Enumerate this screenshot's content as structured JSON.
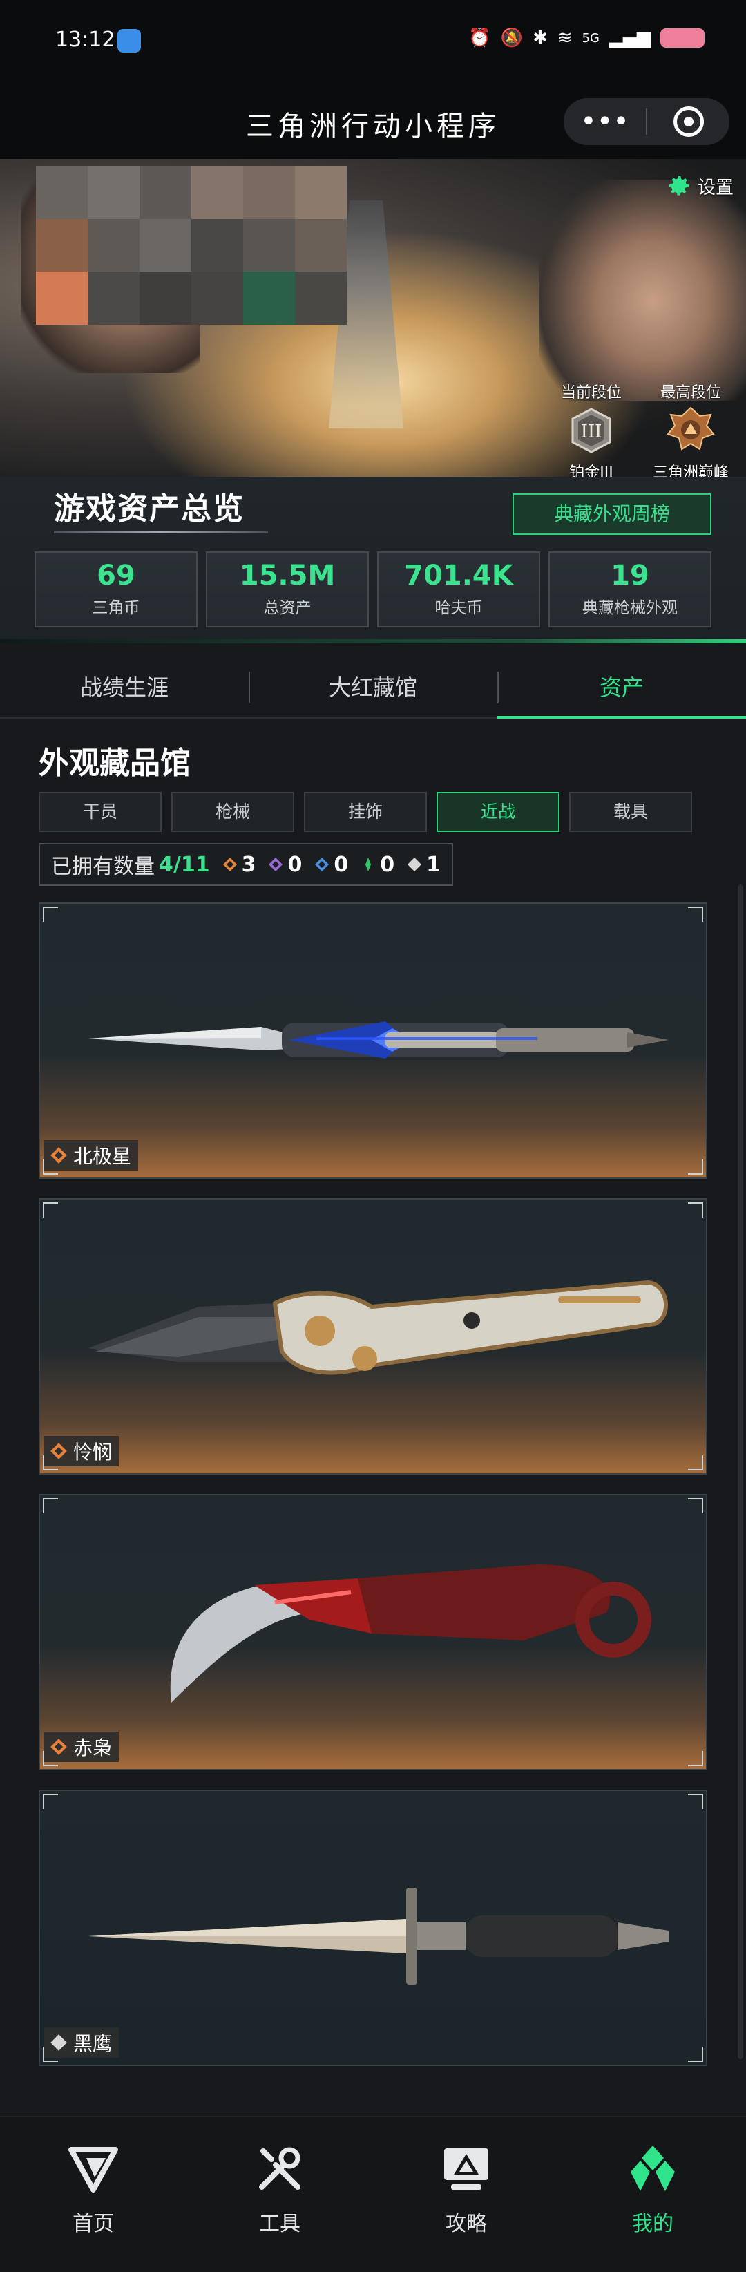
{
  "status_bar": {
    "time": "13:12",
    "network": "5G"
  },
  "title_bar": {
    "title": "三角洲行动小程序",
    "more": "•••"
  },
  "hero": {
    "settings_label": "设置",
    "current_rank": {
      "caption": "当前段位",
      "name": "铂金III"
    },
    "highest_rank": {
      "caption": "最高段位",
      "name": "三角洲巅峰"
    }
  },
  "overview": {
    "title": "游戏资产总览",
    "weekly_button": "典藏外观周榜",
    "stats": [
      {
        "value": "69",
        "label": "三角币"
      },
      {
        "value": "15.5M",
        "label": "总资产"
      },
      {
        "value": "701.4K",
        "label": "哈夫币"
      },
      {
        "value": "19",
        "label": "典藏枪械外观"
      }
    ]
  },
  "tabs": [
    "战绩生涯",
    "大红藏馆",
    "资产"
  ],
  "gallery": {
    "title": "外观藏品馆",
    "categories": [
      "干员",
      "枪械",
      "挂饰",
      "近战",
      "载具"
    ],
    "owned_label": "已拥有数量",
    "owned_count": "4/11",
    "rarity_counts": {
      "orange": "3",
      "purple": "0",
      "blue": "0",
      "green": "0",
      "white": "1"
    },
    "items": [
      {
        "name": "北极星",
        "rarity": "orange"
      },
      {
        "name": "怜悯",
        "rarity": "orange"
      },
      {
        "name": "赤枭",
        "rarity": "orange"
      },
      {
        "name": "黑鹰",
        "rarity": "white"
      }
    ]
  },
  "bottom_nav": [
    "首页",
    "工具",
    "攻略",
    "我的"
  ],
  "colors": {
    "accent": "#2fe48a",
    "orange": "#e8823a",
    "purple": "#9a6ad8",
    "blue": "#4a8fe0",
    "green": "#34c46c",
    "white": "#d8d8d8"
  }
}
